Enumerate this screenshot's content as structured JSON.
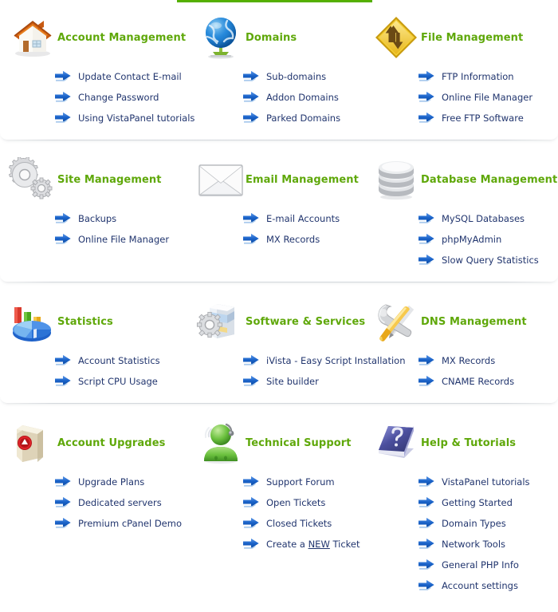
{
  "accent_colors": {
    "top_bar": "#55b000",
    "heading": "#5fa80a",
    "link": "#21356e",
    "arrow": "#1c63c4",
    "panel_bg": "#ffffff"
  },
  "top_bar": {
    "name": "top-accent-bar"
  },
  "rows": [
    {
      "categories": [
        {
          "title": "Account Management",
          "icon": "house-icon",
          "links": [
            {
              "label": "Update Contact E-mail"
            },
            {
              "label": "Change Password"
            },
            {
              "label": "Using VistaPanel tutorials"
            }
          ]
        },
        {
          "title": "Domains",
          "icon": "globe-icon",
          "links": [
            {
              "label": "Sub-domains"
            },
            {
              "label": "Addon Domains"
            },
            {
              "label": "Parked Domains"
            }
          ]
        },
        {
          "title": "File Management",
          "icon": "updown-arrows-diamond-icon",
          "links": [
            {
              "label": "FTP Information"
            },
            {
              "label": "Online File Manager"
            },
            {
              "label": "Free FTP Software"
            }
          ]
        }
      ]
    },
    {
      "categories": [
        {
          "title": "Site Management",
          "icon": "gears-icon",
          "links": [
            {
              "label": "Backups"
            },
            {
              "label": "Online File Manager"
            }
          ]
        },
        {
          "title": "Email Management",
          "icon": "envelope-icon",
          "links": [
            {
              "label": "E-mail Accounts"
            },
            {
              "label": "MX Records"
            }
          ]
        },
        {
          "title": "Database Management",
          "icon": "database-icon",
          "links": [
            {
              "label": "MySQL Databases"
            },
            {
              "label": "phpMyAdmin"
            },
            {
              "label": "Slow Query Statistics"
            }
          ]
        }
      ]
    },
    {
      "categories": [
        {
          "title": "Statistics",
          "icon": "pie-bar-chart-icon",
          "links": [
            {
              "label": "Account Statistics"
            },
            {
              "label": "Script CPU Usage"
            }
          ]
        },
        {
          "title": "Software & Services",
          "icon": "software-box-gear-icon",
          "links": [
            {
              "label": "iVista - Easy Script Installation"
            },
            {
              "label": "Site builder"
            }
          ]
        },
        {
          "title": "DNS Management",
          "icon": "wrench-screwdriver-icon",
          "links": [
            {
              "label": "MX Records"
            },
            {
              "label": "CNAME Records"
            }
          ]
        }
      ]
    },
    {
      "categories": [
        {
          "title": "Account Upgrades",
          "icon": "package-box-icon",
          "links": [
            {
              "label": "Upgrade Plans"
            },
            {
              "label": "Dedicated servers"
            },
            {
              "label": "Premium cPanel Demo"
            }
          ]
        },
        {
          "title": "Technical Support",
          "icon": "support-headset-person-icon",
          "links": [
            {
              "label": "Support Forum"
            },
            {
              "label": "Open Tickets"
            },
            {
              "label": "Closed Tickets"
            },
            {
              "label": "Create a ",
              "underlined": "NEW",
              "label_after": " Ticket"
            }
          ]
        },
        {
          "title": "Help & Tutorials",
          "icon": "question-book-icon",
          "links": [
            {
              "label": "VistaPanel tutorials"
            },
            {
              "label": "Getting Started"
            },
            {
              "label": "Domain Types"
            },
            {
              "label": "Network Tools"
            },
            {
              "label": "General PHP Info"
            },
            {
              "label": "Account settings"
            }
          ]
        }
      ]
    }
  ]
}
